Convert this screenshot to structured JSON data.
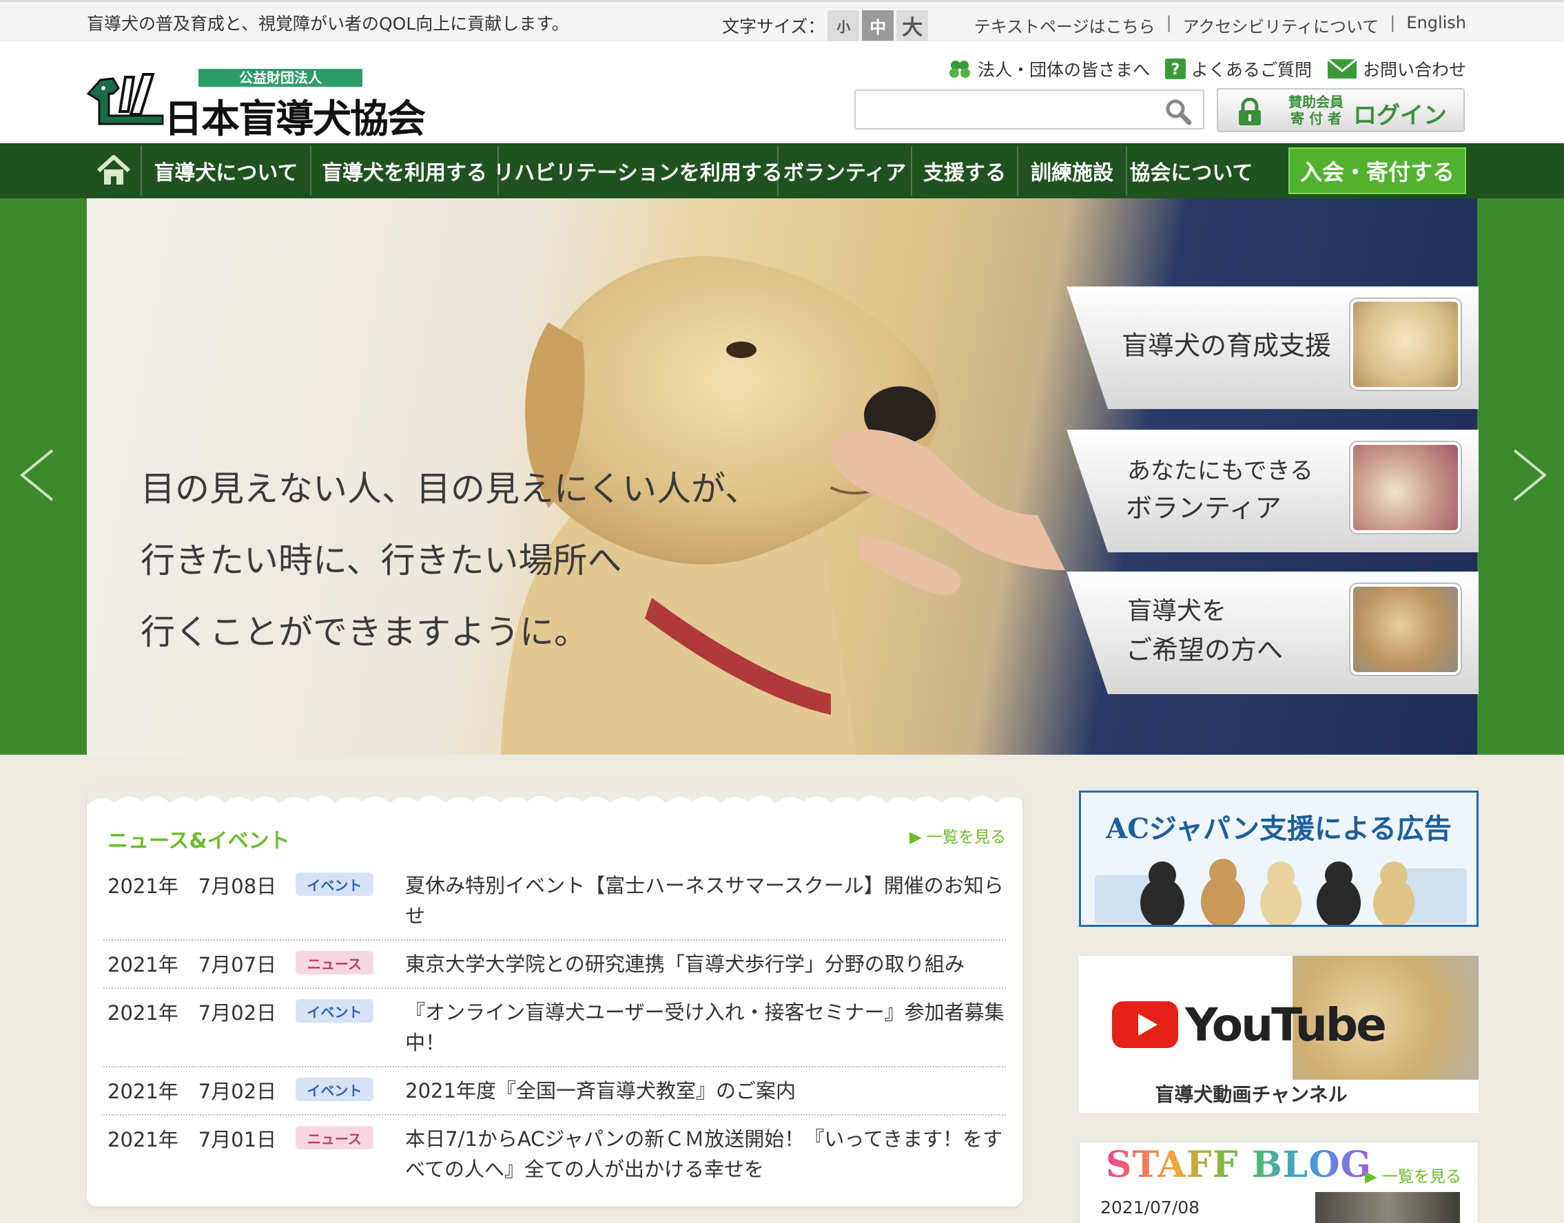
{
  "utility": {
    "tagline": "盲導犬の普及育成と、視覚障がい者のQOL向上に貢献します。",
    "fontsize_label": "文字サイズ：",
    "fontsize_small": "小",
    "fontsize_mid": "中",
    "fontsize_large": "大",
    "links": [
      "テキストページはこちら",
      "アクセシビリティについて",
      "English"
    ],
    "separator": "|"
  },
  "header": {
    "logo_badge": "公益財団法人",
    "logo_name": "日本盲導犬協会",
    "links": [
      "法人・団体の皆さまへ",
      "よくあるご質問",
      "お問い合わせ"
    ],
    "search_placeholder": "",
    "login_members_1": "賛助会員",
    "login_members_2": "寄 付 者",
    "login_label": "ログイン"
  },
  "nav": {
    "items": [
      "盲導犬について",
      "盲導犬を利用する",
      "リハビリテーションを利用する",
      "ボランティア",
      "支援する",
      "訓練施設",
      "協会について"
    ],
    "join": "入会・寄付する"
  },
  "hero": {
    "copy": [
      "目の見えない人、目の見えにくい人が、",
      "行きたい時に、行きたい場所へ",
      "行くことができますように。"
    ],
    "promos": [
      {
        "lines": [
          "盲導犬の育成支援"
        ]
      },
      {
        "lines": [
          "あなたにもできる",
          "ボランティア"
        ]
      },
      {
        "lines": [
          "盲導犬を",
          "ご希望の方へ"
        ]
      }
    ]
  },
  "news": {
    "title": "ニュース&イベント",
    "more": "▶ 一覧を見る",
    "items": [
      {
        "date": "2021年　7月08日",
        "tag": "イベント",
        "kind": "event",
        "title": "夏休み特別イベント【富士ハーネスサマースクール】開催のお知らせ"
      },
      {
        "date": "2021年　7月07日",
        "tag": "ニュース",
        "kind": "news",
        "title": "東京大学大学院との研究連携「盲導犬歩行学」分野の取り組み"
      },
      {
        "date": "2021年　7月02日",
        "tag": "イベント",
        "kind": "event",
        "title": "『オンライン盲導犬ユーザー受け入れ・接客セミナー』参加者募集中！"
      },
      {
        "date": "2021年　7月02日",
        "tag": "イベント",
        "kind": "event",
        "title": "2021年度『全国一斉盲導犬教室』のご案内"
      },
      {
        "date": "2021年　7月01日",
        "tag": "ニュース",
        "kind": "news",
        "title": "本日7/1からACジャパンの新ＣＭ放送開始！『いってきます！をすべての人へ』全ての人が出かける幸せを"
      }
    ]
  },
  "sidebar": {
    "ac_title": "ACジャパン支援による広告",
    "youtube_word": "YouTube",
    "youtube_caption": "盲導犬動画チャンネル",
    "blog_title": "STAFF BLOG",
    "blog_more": "▶ 一覧を見る",
    "blog_date": "2021/07/08"
  },
  "colors": {
    "nav_bg": "#1f521f",
    "join_bg": "#52b22f",
    "hero_side": "#3c8a2b",
    "accent_green": "#6bbd2a",
    "event_badge": "#d6e3f7",
    "news_badge": "#f6d7e2"
  }
}
